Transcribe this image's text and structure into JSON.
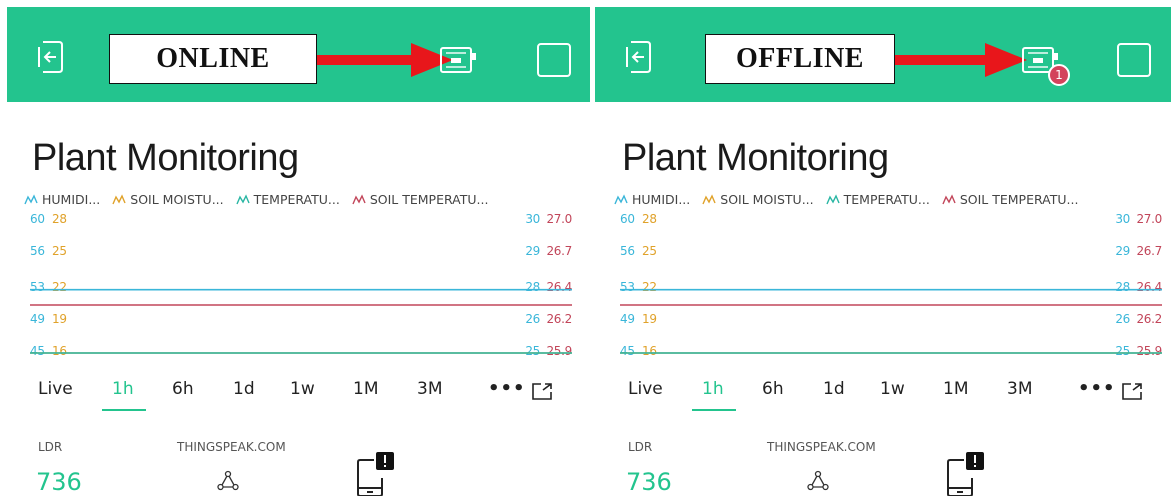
{
  "colors": {
    "accent": "#23c48e",
    "humidity": "#3ab6d9",
    "soil_moisture": "#e0a22a",
    "temperature": "#29b6a3",
    "soil_temperature": "#c2465a",
    "badge": "#d3435c",
    "arrow": "#e8161b"
  },
  "panels": [
    {
      "status_label": "ONLINE",
      "badge": "",
      "title": "Plant Monitoring",
      "legend": [
        "HUMIDI...",
        "SOIL MOISTU...",
        "TEMPERATU...",
        "SOIL TEMPERATU..."
      ],
      "left_ticks_a": [
        "60",
        "56",
        "53",
        "49",
        "45"
      ],
      "left_ticks_b": [
        "28",
        "25",
        "22",
        "19",
        "16"
      ],
      "right_ticks_a": [
        "30",
        "29",
        "28",
        "26",
        "25"
      ],
      "right_ticks_b": [
        "27.0",
        "26.7",
        "26.4",
        "26.2",
        "25.9"
      ],
      "tabs": [
        "Live",
        "1h",
        "6h",
        "1d",
        "1w",
        "1M",
        "3M"
      ],
      "active_tab": "1h",
      "widgets": {
        "ldr_label": "LDR",
        "ldr_value": "736",
        "webhook_label": "THINGSPEAK.COM"
      }
    },
    {
      "status_label": "OFFLINE",
      "badge": "1",
      "title": "Plant Monitoring",
      "legend": [
        "HUMIDI...",
        "SOIL MOISTU...",
        "TEMPERATU...",
        "SOIL TEMPERATU..."
      ],
      "left_ticks_a": [
        "60",
        "56",
        "53",
        "49",
        "45"
      ],
      "left_ticks_b": [
        "28",
        "25",
        "22",
        "19",
        "16"
      ],
      "right_ticks_a": [
        "30",
        "29",
        "28",
        "26",
        "25"
      ],
      "right_ticks_b": [
        "27.0",
        "26.7",
        "26.4",
        "26.2",
        "25.9"
      ],
      "tabs": [
        "Live",
        "1h",
        "6h",
        "1d",
        "1w",
        "1M",
        "3M"
      ],
      "active_tab": "1h",
      "widgets": {
        "ldr_label": "LDR",
        "ldr_value": "736",
        "webhook_label": "THINGSPEAK.COM"
      }
    }
  ],
  "chart_data": {
    "type": "line",
    "series": [
      {
        "name": "HUMIDI...",
        "axis": "left",
        "ylim": [
          45,
          60
        ],
        "values": [
          52.2,
          52.2
        ]
      },
      {
        "name": "SOIL MOISTU...",
        "axis": "left",
        "ylim": [
          16,
          28
        ],
        "values": [
          16,
          16
        ]
      },
      {
        "name": "TEMPERATU...",
        "axis": "right",
        "ylim": [
          25,
          30
        ],
        "values": [
          25,
          25
        ]
      },
      {
        "name": "SOIL TEMPERATU...",
        "axis": "right",
        "ylim": [
          25.9,
          27.0
        ],
        "values": [
          26.3,
          26.3
        ]
      }
    ],
    "grid": false
  }
}
